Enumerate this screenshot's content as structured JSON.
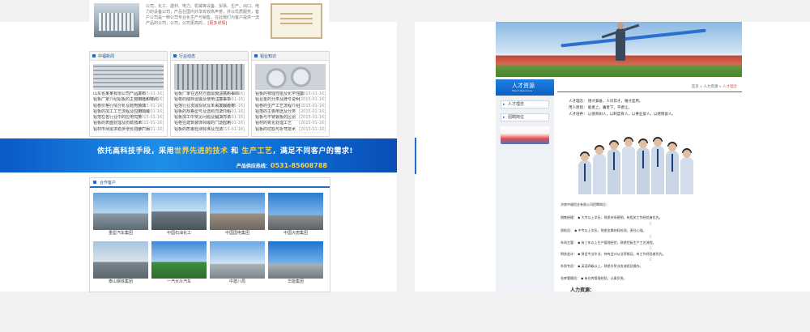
{
  "left_site": {
    "intro": {
      "text": "公司，化工、建材、电力、机械等设备、贸易、生产、出口、电力的设备公司，产品在国内外享有较高声誉，并以优质服务，客户公司是一种公司专业化生产与销售，在此我们为客户提供一流产品的公司，公司，公司更高的...",
      "more": "[更多详情]"
    },
    "boxes": [
      {
        "title": "中福新闻",
        "rows": [
          {
            "text": "山东省某某有限公司产品发布",
            "date": "[2015-01-16]"
          },
          {
            "text": "铝板厂家介绍铝板的主要用途和特点",
            "date": "[2015-01-16]"
          },
          {
            "text": "铝卷价格行情分析及趋势预测",
            "date": "[2015-01-16]"
          },
          {
            "text": "铝板的加工工艺流程及应用领域",
            "date": "[2015-01-16]"
          },
          {
            "text": "铝箔在各行业中的应用优势",
            "date": "[2015-01-16]"
          },
          {
            "text": "铝板的表面处理及防腐技术",
            "date": "[2015-01-16]"
          },
          {
            "text": "铝材市场需求稳步增长前景广阔",
            "date": "[2015-01-16]"
          }
        ]
      },
      {
        "title": "行业动态",
        "rows": [
          {
            "text": "铝板厂家在选材方面需要注意的事项",
            "date": "[2015-01-16]"
          },
          {
            "text": "铝卷的储存运输及使用注意事项",
            "date": "[2015-01-16]"
          },
          {
            "text": "铝箔行业发展现状及未来发展趋势",
            "date": "[2015-01-16]"
          },
          {
            "text": "铝板的规格型号及选购方法介绍",
            "date": "[2015-01-16]"
          },
          {
            "text": "铝板加工中常见问题及解决方法",
            "date": "[2015-01-16]"
          },
          {
            "text": "铝卷在建筑装饰领域的广泛应用",
            "date": "[2015-01-16]"
          },
          {
            "text": "铝板的质量检测标准及方法",
            "date": "[2015-01-16]"
          }
        ]
      },
      {
        "title": "铝业知识",
        "rows": [
          {
            "text": "铝板的物理性能及化学性能",
            "date": "[2015-01-16]"
          },
          {
            "text": "铝合金的分类及牌号说明",
            "date": "[2015-01-16]"
          },
          {
            "text": "铝卷的生产工艺流程介绍",
            "date": "[2015-01-16]"
          },
          {
            "text": "铝箔的主要用途及分类",
            "date": "[2015-01-16]"
          },
          {
            "text": "铝板与不锈钢板的区别",
            "date": "[2015-01-16]"
          },
          {
            "text": "铝材的氧化处理工艺",
            "date": "[2015-01-16]"
          },
          {
            "text": "铝板的切割与折弯技术",
            "date": "[2015-01-16]"
          }
        ]
      }
    ],
    "banner": {
      "line1_a": "依托高科技手段，采用",
      "line1_hl1": "世界先进的技术",
      "line1_b": " 和 ",
      "line1_hl2": "生产工艺",
      "line1_c": "，满足不同客户的需求!",
      "hotline_label": "产品供应热线：",
      "hotline_number": "0531-85608788"
    },
    "clients": {
      "title": "合作客户",
      "items": [
        {
          "caption": "重型汽车集团"
        },
        {
          "caption": "中国石油化工"
        },
        {
          "caption": "中国国电集团"
        },
        {
          "caption": "中国大唐集团"
        },
        {
          "caption": "泰山钢铁集团"
        },
        {
          "caption": "一汽大众汽车"
        },
        {
          "caption": "中建八局"
        },
        {
          "caption": "华能集团"
        }
      ]
    }
  },
  "right_site": {
    "sidebar": {
      "title": "人才资源",
      "subtitle": "Talent Resources",
      "items": [
        {
          "label": "人才理念"
        },
        {
          "label": "招聘岗位"
        }
      ]
    },
    "breadcrumb": {
      "home": "首页",
      "sep1": " » ",
      "section": "人力资源",
      "sep2": " » ",
      "current": "人才理念"
    },
    "intro_lines": [
      "人才理念： 德才兼备，人尽其才，唯才是用。",
      "用人原则： 能者上，庸者下，平者让。",
      "人才培养： 以德育树人，以制度育人，以事业留人，以感情留人。"
    ],
    "jobs_header": "济南中福铝业有限公司招聘岗位：",
    "jobs": [
      {
        "label": "销售经理：",
        "text": "◆ 大专以上学历，熟悉市场营销，有相关工作经验者优先。"
      },
      {
        "label": "质检员：",
        "text": "◆ 中专以上学历，熟悉金属材料检测，责任心强。"
      },
      {
        "label": "车间主管：",
        "text": "◆ 有三年以上生产管理经验，熟悉铝板生产工艺流程。"
      },
      {
        "label": "财务会计：",
        "text": "◆ 财会专业毕业，持有会计从业资格证，有工作经验者优先。"
      },
      {
        "label": "外贸专员：",
        "text": "◆ 英语四级以上，熟悉外贸业务流程及操作。"
      },
      {
        "label": "仓库管理员：",
        "text": "◆ 有仓库管理经验，认真负责。"
      }
    ],
    "center_mark": "C",
    "resource_title": "人力资源："
  }
}
